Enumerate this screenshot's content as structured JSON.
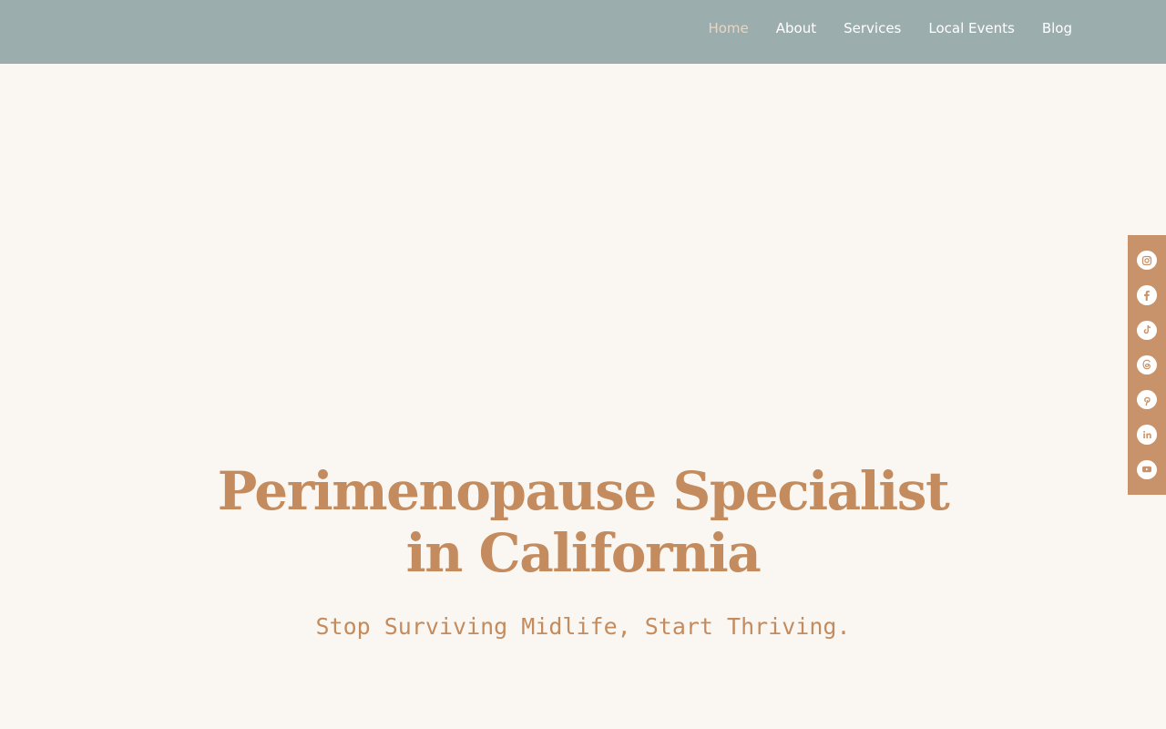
{
  "nav": {
    "items": [
      {
        "label": "Home",
        "active": true
      },
      {
        "label": "About"
      },
      {
        "label": "Services"
      },
      {
        "label": "Local Events"
      },
      {
        "label": "Blog"
      }
    ]
  },
  "social": {
    "icons": [
      "instagram-icon",
      "facebook-icon",
      "tiktok-icon",
      "threads-icon",
      "pinterest-icon",
      "linkedin-icon",
      "youtube-icon"
    ]
  },
  "hero": {
    "title": "Perimenopause Specialist in California",
    "subtitle": "Stop Surviving Midlife, Start Thriving."
  },
  "colors": {
    "header_bg": "#9cadad",
    "page_bg": "#faf7f2",
    "accent": "#c48c5e",
    "social_bg": "#c8936a",
    "active_nav": "#e7d6c4"
  }
}
